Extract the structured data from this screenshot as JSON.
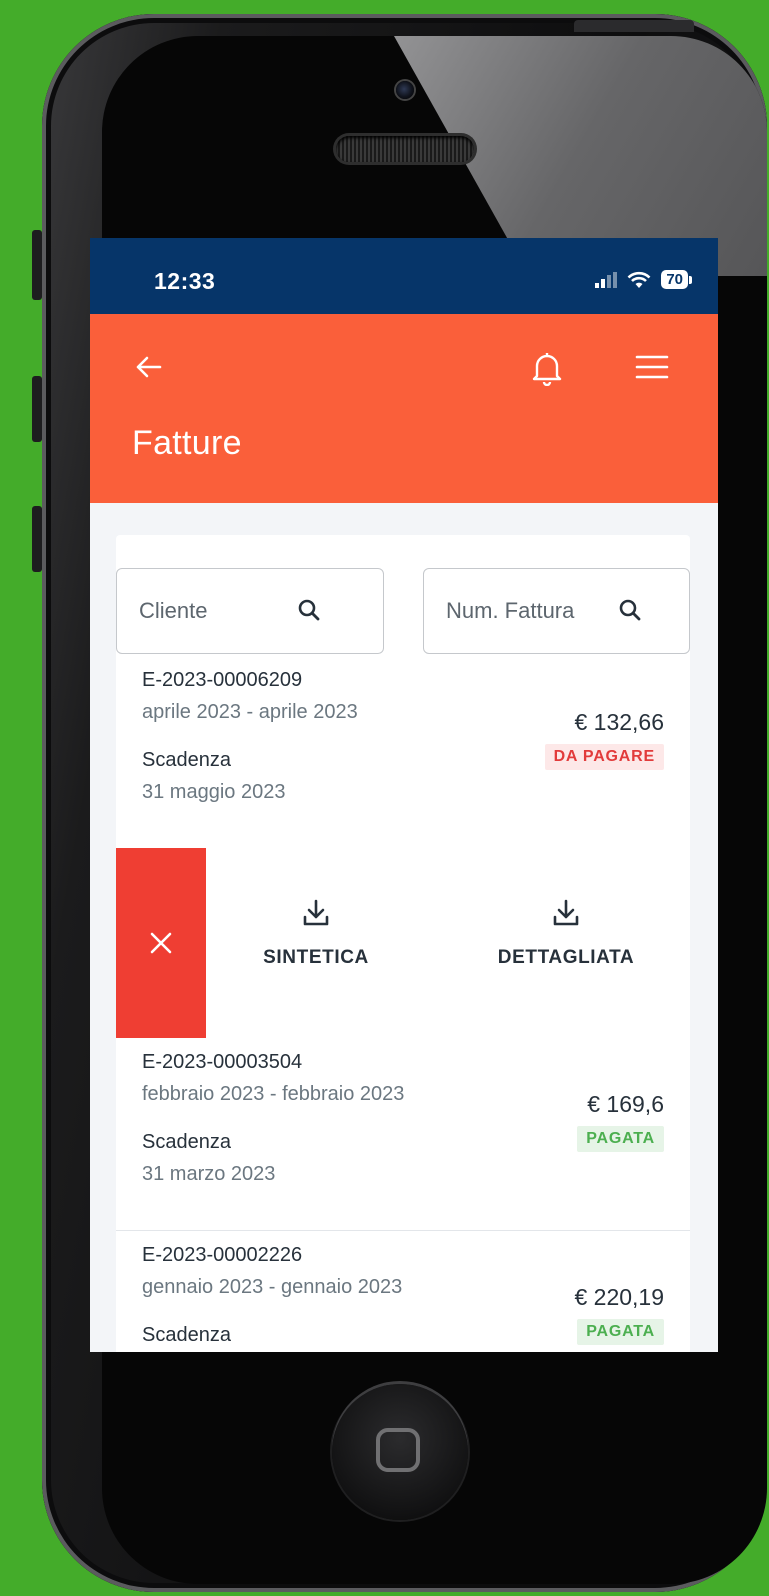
{
  "status_bar": {
    "time": "12:33",
    "battery": "70"
  },
  "header": {
    "title": "Fatture"
  },
  "search": {
    "client_placeholder": "Cliente",
    "number_placeholder": "Num. Fattura"
  },
  "invoices": [
    {
      "number": "E-2023-00006209",
      "period": "aprile 2023 - aprile 2023",
      "due_label": "Scadenza",
      "due_date": "31 maggio 2023",
      "amount": "€ 132,66",
      "status": "DA PAGARE"
    },
    {
      "number": "E-2023-00003504",
      "period": "febbraio 2023 - febbraio 2023",
      "due_label": "Scadenza",
      "due_date": "31 marzo 2023",
      "amount": "€ 169,6",
      "status": "PAGATA"
    },
    {
      "number": "E-2023-00002226",
      "period": "gennaio 2023 - gennaio 2023",
      "due_label": "Scadenza",
      "due_date": "",
      "amount": "€ 220,19",
      "status": "PAGATA"
    }
  ],
  "actions": {
    "summary_label": "SINTETICA",
    "detailed_label": "DETTAGLIATA"
  },
  "colors": {
    "background": "#44ac2a",
    "status_bar": "#063569",
    "header": "#fa5f3a",
    "close": "#ef3e33",
    "unpaid": "#e23b3b",
    "paid": "#4caf50"
  },
  "icons": [
    "back-arrow-icon",
    "bell-icon",
    "menu-icon",
    "search-icon",
    "download-icon",
    "close-icon",
    "signal-icon",
    "wifi-icon",
    "battery-icon"
  ]
}
